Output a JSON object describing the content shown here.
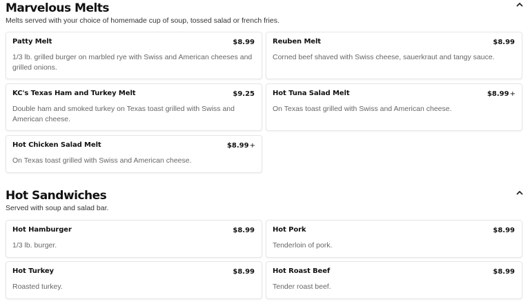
{
  "sections": [
    {
      "title": "Marvelous Melts",
      "description": "Melts served with your choice of homemade cup of soup, tossed salad or french fries.",
      "items": [
        {
          "name": "Patty Melt",
          "price": "$8.99",
          "plus": "",
          "description": "1/3 lb. grilled burger on marbled rye with Swiss and American cheeses and grilled onions."
        },
        {
          "name": "Reuben Melt",
          "price": "$8.99",
          "plus": "",
          "description": "Corned beef shaved with Swiss cheese, sauerkraut and tangy sauce."
        },
        {
          "name": "KC's Texas Ham and Turkey Melt",
          "price": "$9.25",
          "plus": "",
          "description": "Double ham and smoked turkey on Texas toast grilled with Swiss and American cheese."
        },
        {
          "name": "Hot Tuna Salad Melt",
          "price": "$8.99",
          "plus": "+",
          "description": "On Texas toast grilled with Swiss and American cheese."
        },
        {
          "name": "Hot Chicken Salad Melt",
          "price": "$8.99",
          "plus": "+",
          "description": "On Texas toast grilled with Swiss and American cheese."
        }
      ]
    },
    {
      "title": "Hot Sandwiches",
      "description": "Served with soup and salad bar.",
      "items": [
        {
          "name": "Hot Hamburger",
          "price": "$8.99",
          "plus": "",
          "description": "1/3 lb. burger."
        },
        {
          "name": "Hot Pork",
          "price": "$8.99",
          "plus": "",
          "description": "Tenderloin of pork."
        },
        {
          "name": "Hot Turkey",
          "price": "$8.99",
          "plus": "",
          "description": "Roasted turkey."
        },
        {
          "name": "Hot Roast Beef",
          "price": "$8.99",
          "plus": "",
          "description": "Tender roast beef."
        }
      ]
    }
  ],
  "icons": {
    "collapse": "chevron-up-icon"
  }
}
